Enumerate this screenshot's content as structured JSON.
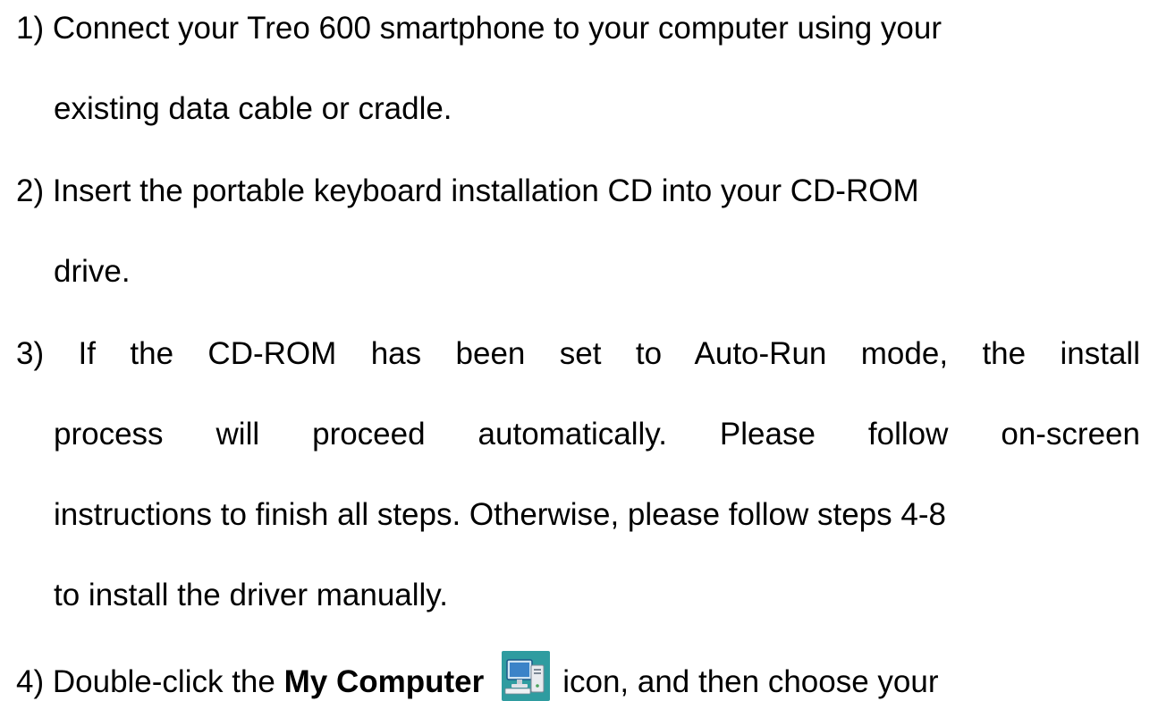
{
  "steps": [
    {
      "number": "1)",
      "lines": [
        "Connect your Treo 600 smartphone to your computer using your",
        "existing data cable or cradle."
      ]
    },
    {
      "number": "2)",
      "lines": [
        "Insert the portable keyboard installation CD into your CD-ROM",
        "drive."
      ]
    },
    {
      "number": "3)",
      "lines": [
        "If the CD-ROM has been set to Auto-Run mode, the install",
        "process will proceed automatically. Please follow on-screen",
        "instructions to finish all steps. Otherwise, please follow steps 4-8",
        "to install the driver manually."
      ]
    },
    {
      "number": "4)",
      "prefix": "Double-click the",
      "bold": "My Computer",
      "icon": "my-computer-icon",
      "suffix": "icon, and then choose your"
    }
  ],
  "colors": {
    "text": "#000000",
    "icon_bg": "#2f9ca0",
    "icon_monitor": "#3b83c8"
  }
}
